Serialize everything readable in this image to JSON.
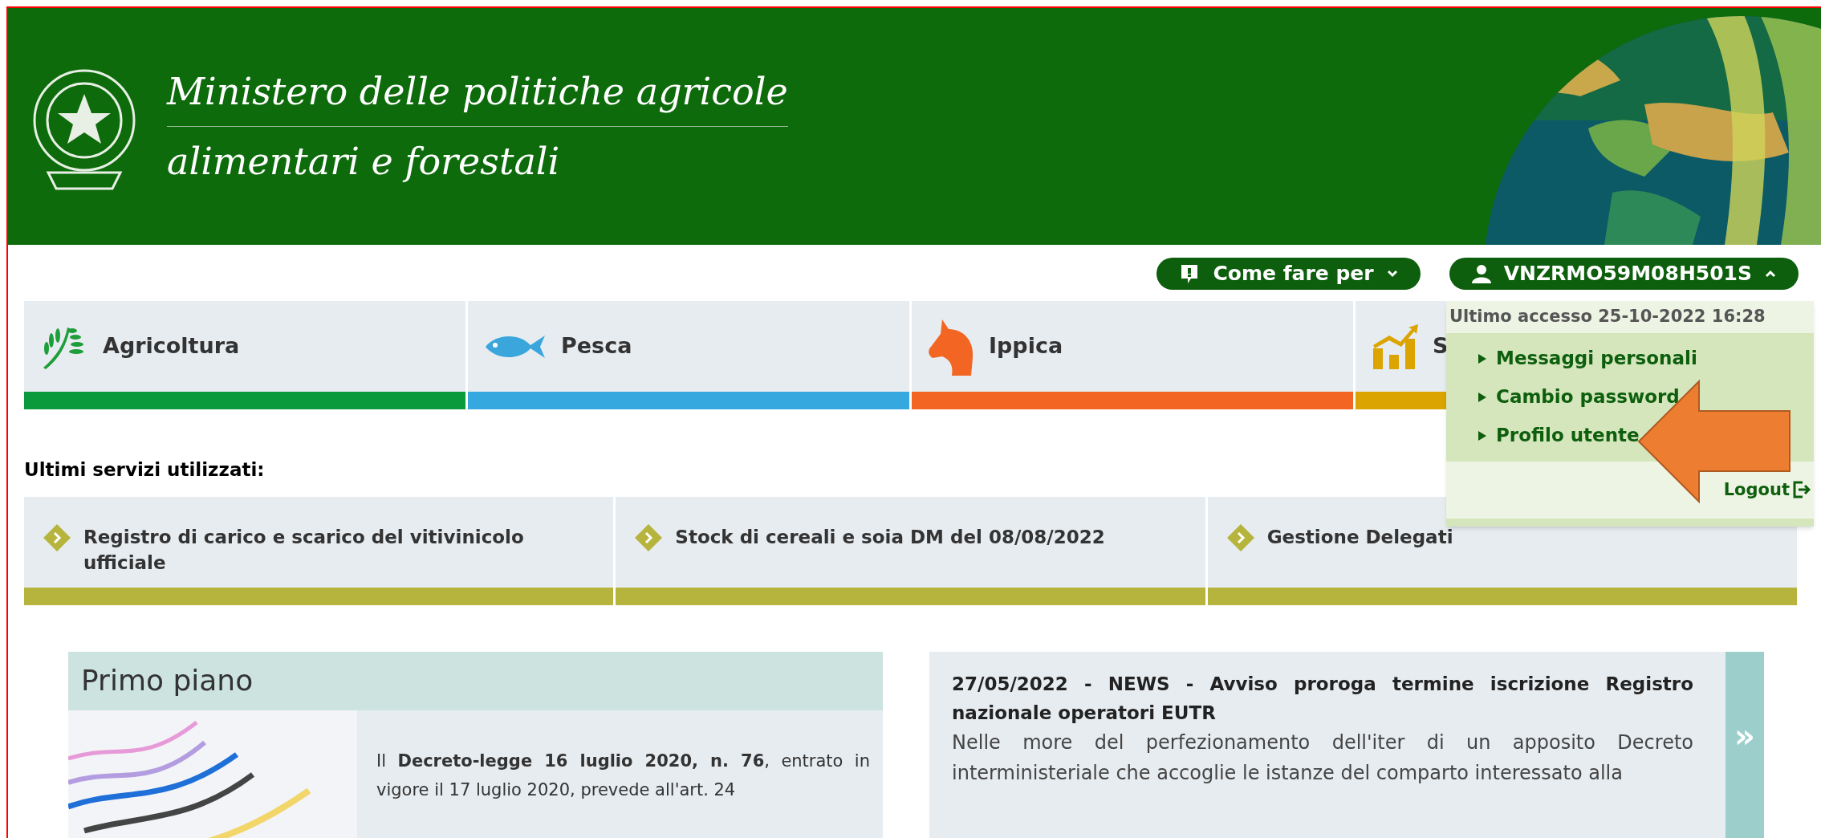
{
  "header": {
    "title_line1": "Ministero delle politiche agricole",
    "title_line2": "alimentari e forestali"
  },
  "top_buttons": [
    {
      "kind": "help",
      "label": "Come fare per",
      "expanded": false
    },
    {
      "kind": "user",
      "label": "VNZRMO59M08H501S",
      "expanded": true
    }
  ],
  "user_menu": {
    "last_access": "Ultimo accesso 25-10-2022 16:28",
    "items": [
      "Messaggi personali",
      "Cambio password",
      "Profilo utente"
    ],
    "logout": "Logout"
  },
  "categories": [
    {
      "kind": "wheat",
      "label": "Agricoltura",
      "color": "#0a9a3c"
    },
    {
      "kind": "fish",
      "label": "Pesca",
      "color": "#35a8e0"
    },
    {
      "kind": "horse",
      "label": "Ippica",
      "color": "#f26522"
    },
    {
      "kind": "chart",
      "label": "S",
      "color": "#dba400"
    }
  ],
  "recent_services": {
    "heading": "Ultimi servizi utilizzati:",
    "items": [
      "Registro di carico e scarico del vitivinicolo ufficiale",
      "Stock di cereali e soia DM del 08/08/2022",
      "Gestione Delegati"
    ]
  },
  "primo_piano": {
    "title": "Primo piano",
    "text": "Il **Decreto-legge 16 luglio 2020, n. 76**, entrato in vigore il 17 luglio 2020, prevede all'art. 24"
  },
  "news": {
    "title": "27/05/2022 - NEWS - Avviso proroga termine iscrizione Registro nazionale operatori EUTR",
    "text": "Nelle more del perfezionamento dell'iter di un apposito Decreto interministeriale che accoglie le istanze del comparto interessato alla",
    "arrow": "»"
  }
}
